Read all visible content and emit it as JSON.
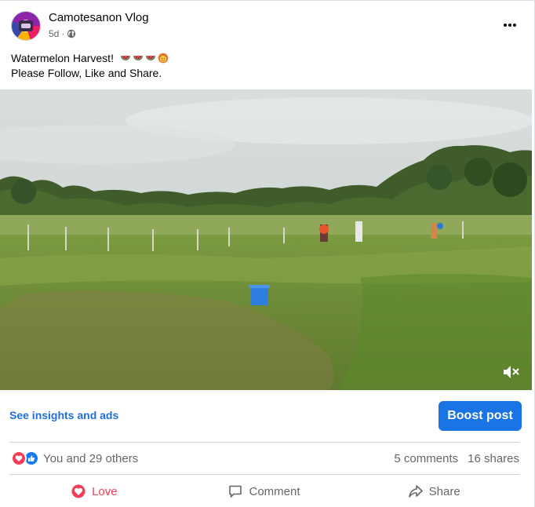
{
  "post": {
    "page_name": "Camotesanon Vlog",
    "time": "5d",
    "separator": "·",
    "audience_icon": "globe-icon",
    "caption_line1": "Watermelon Harvest!",
    "caption_emojis": [
      "watermelon-emoji",
      "watermelon-emoji",
      "watermelon-emoji",
      "woman-emoji"
    ],
    "caption_line2": "Please Follow, Like and Share."
  },
  "video": {
    "description_icon": "muted-speaker-icon"
  },
  "insights": {
    "link_label": "See insights and ads",
    "boost_label": "Boost post"
  },
  "summary": {
    "reaction_icons": [
      "love-reaction-icon",
      "like-reaction-icon"
    ],
    "reactions_text": "You and 29 others",
    "comments": "5 comments",
    "shares": "16 shares"
  },
  "actions": {
    "love_label": "Love",
    "comment_label": "Comment",
    "share_label": "Share"
  },
  "colors": {
    "brand_blue": "#1b74e4",
    "link_blue": "#216fdb",
    "love_red": "#f33e58",
    "secondary_text": "#65676b"
  }
}
